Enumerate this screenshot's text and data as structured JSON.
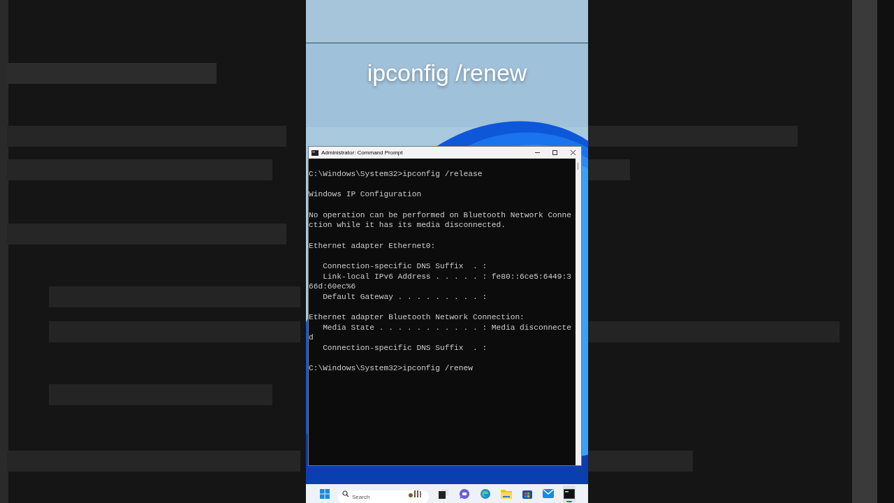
{
  "caption": "ipconfig /renew",
  "window": {
    "title": "Administrator: Command Prompt"
  },
  "console": [
    {
      "text": "C:\\Windows\\System32>ipconfig /release",
      "gap_before": false
    },
    {
      "text": "Windows IP Configuration",
      "gap_before": true
    },
    {
      "text": "No operation can be performed on Bluetooth Network Conne",
      "gap_before": true
    },
    {
      "text": "ction while it has its media disconnected.",
      "gap_before": false
    },
    {
      "text": "Ethernet adapter Ethernet0:",
      "gap_before": true
    },
    {
      "text": "   Connection-specific DNS Suffix  . :",
      "gap_before": true
    },
    {
      "text": "   Link-local IPv6 Address . . . . . : fe80::6ce5:6449:3",
      "gap_before": false
    },
    {
      "text": "66d:60ec%6",
      "gap_before": false
    },
    {
      "text": "   Default Gateway . . . . . . . . . :",
      "gap_before": false
    },
    {
      "text": "Ethernet adapter Bluetooth Network Connection:",
      "gap_before": true
    },
    {
      "text": "   Media State . . . . . . . . . . . : Media disconnecte",
      "gap_before": false
    },
    {
      "text": "d",
      "gap_before": false
    },
    {
      "text": "   Connection-specific DNS Suffix  . :",
      "gap_before": false
    },
    {
      "text": "C:\\Windows\\System32>ipconfig /renew",
      "gap_before": true
    }
  ],
  "taskbar": {
    "search": {
      "placeholder": "Search"
    },
    "apps": [
      {
        "kind": "taskview",
        "running": false
      },
      {
        "kind": "chat",
        "running": false
      },
      {
        "kind": "edge",
        "running": false
      },
      {
        "kind": "folder",
        "running": false
      },
      {
        "kind": "store",
        "running": false
      },
      {
        "kind": "mail",
        "running": false
      },
      {
        "kind": "terminal",
        "running": true
      }
    ]
  }
}
